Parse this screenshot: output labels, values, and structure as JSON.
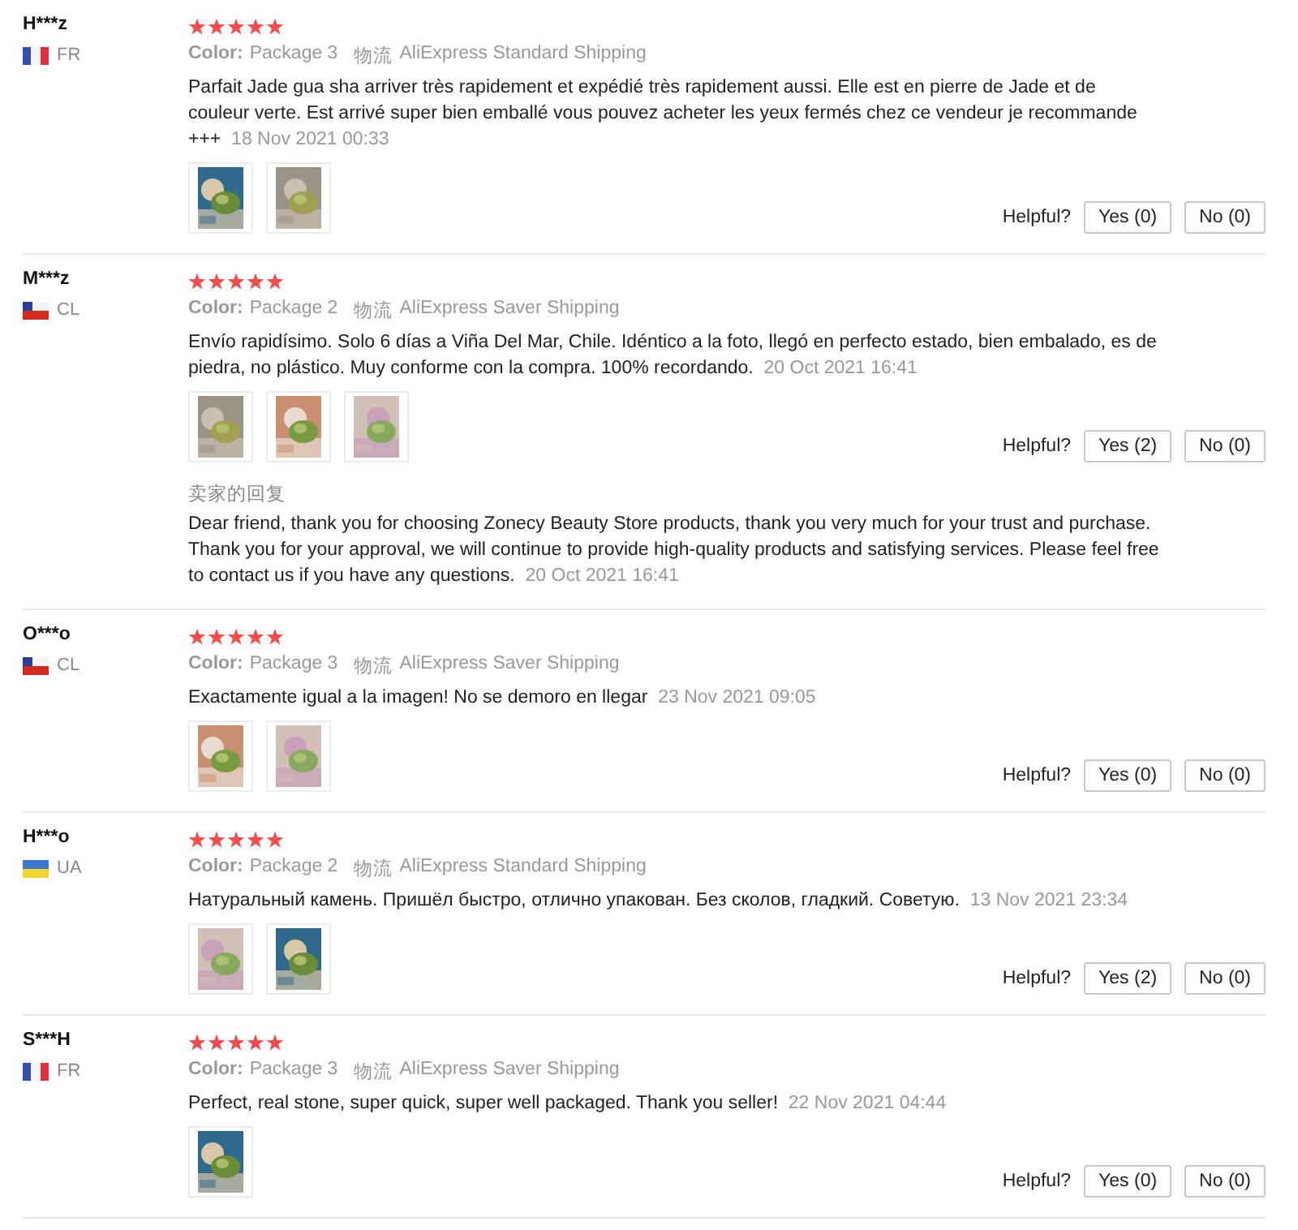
{
  "reviews": [
    {
      "user": "H***z",
      "flag": {
        "kind": "france"
      },
      "country": "FR",
      "stars": 5,
      "color_label": "Color:",
      "color_value": "Package 3",
      "shipping_label": "物流",
      "shipping": "AliExpress Standard Shipping",
      "text": "Parfait Jade gua sha arriver très rapidement et expédié très rapidement aussi. Elle est en pierre de Jade et de couleur verte. Est arrivé super bien emballé vous pouvez acheter les yeux fermés chez ce vendeur je recommande +++",
      "date": "18 Nov 2021 00:33",
      "photos": [
        {
          "kind": "picture"
        },
        {
          "kind": "picture"
        }
      ],
      "helpful": "Helpful?",
      "yes": "Yes (0)",
      "no": "No (0)"
    },
    {
      "user": "M***z",
      "flag": {
        "kind": "chile"
      },
      "country": "CL",
      "stars": 5,
      "color_label": "Color:",
      "color_value": "Package 2",
      "shipping_label": "物流",
      "shipping": "AliExpress Saver Shipping",
      "text": "Envío rapidísimo. Solo 6 días a Viña Del Mar, Chile. Idéntico a la foto, llegó en perfecto estado, bien embalado, es de piedra, no plástico. Muy conforme con la compra. 100% recordando.",
      "date": "20 Oct 2021 16:41",
      "photos": [
        {
          "kind": "picture"
        },
        {
          "kind": "picture"
        },
        {
          "kind": "picture"
        }
      ],
      "helpful": "Helpful?",
      "yes": "Yes (2)",
      "no": "No (0)",
      "seller_reply": {
        "label": "卖家的回复",
        "text": "Dear friend, thank you for choosing Zonecy Beauty Store products, thank you very much for your trust and purchase. Thank you for your approval, we will continue to provide high-quality products and satisfying services. Please feel free to contact us if you have any questions.",
        "date": "20 Oct 2021 16:41"
      }
    },
    {
      "user": "O***o",
      "flag": {
        "kind": "chile"
      },
      "country": "CL",
      "stars": 5,
      "color_label": "Color:",
      "color_value": "Package 3",
      "shipping_label": "物流",
      "shipping": "AliExpress Saver Shipping",
      "text": "Exactamente igual a la imagen! No se demoro en llegar",
      "date": "23 Nov 2021 09:05",
      "photos": [
        {
          "kind": "picture"
        },
        {
          "kind": "picture"
        }
      ],
      "helpful": "Helpful?",
      "yes": "Yes (0)",
      "no": "No (0)"
    },
    {
      "user": "H***o",
      "flag": {
        "kind": "ukraine"
      },
      "country": "UA",
      "stars": 5,
      "color_label": "Color:",
      "color_value": "Package 2",
      "shipping_label": "物流",
      "shipping": "AliExpress Standard Shipping",
      "text": "Натуральный камень. Пришёл быстро, отлично упакован. Без сколов, гладкий. Советую.",
      "date": "13 Nov 2021 23:34",
      "photos": [
        {
          "kind": "picture"
        },
        {
          "kind": "picture"
        }
      ],
      "helpful": "Helpful?",
      "yes": "Yes (2)",
      "no": "No (0)"
    },
    {
      "user": "S***H",
      "flag": {
        "kind": "france"
      },
      "country": "FR",
      "stars": 5,
      "color_label": "Color:",
      "color_value": "Package 3",
      "shipping_label": "物流",
      "shipping": "AliExpress Saver Shipping",
      "text": "Perfect, real stone, super quick, super well packaged. Thank you seller!",
      "date": "22 Nov 2021 04:44",
      "photos": [
        {
          "kind": "picture"
        }
      ],
      "helpful": "Helpful?",
      "yes": "Yes (0)",
      "no": "No (0)"
    }
  ]
}
